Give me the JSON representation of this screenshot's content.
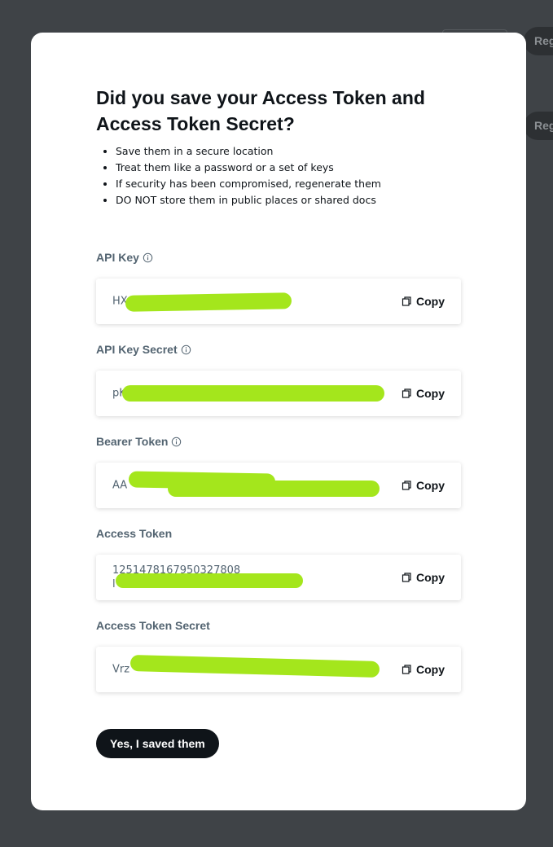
{
  "background": {
    "button_1_label": "Reg",
    "button_2_label": "Reg"
  },
  "modal": {
    "title": "Did you save your Access Token and Access Token Secret?",
    "bullets": [
      "Save them in a secure location",
      "Treat them like a password or a set of keys",
      "If security has been compromised, regenerate them",
      "DO NOT store them in public places or shared docs"
    ],
    "fields": [
      {
        "label": "API Key",
        "has_info": true,
        "value": "HX",
        "copy_label": "Copy"
      },
      {
        "label": "API Key Secret",
        "has_info": true,
        "value": "pK",
        "copy_label": "Copy"
      },
      {
        "label": "Bearer Token",
        "has_info": true,
        "value": "AA",
        "copy_label": "Copy"
      },
      {
        "label": "Access Token",
        "has_info": false,
        "value": "1251478167950327808\nl",
        "copy_label": "Copy"
      },
      {
        "label": "Access Token Secret",
        "has_info": false,
        "value": "Vrz",
        "copy_label": "Copy"
      }
    ],
    "confirm_label": "Yes, I saved them"
  },
  "colors": {
    "overlay": "#3f4347",
    "redaction": "#a4e61c",
    "primary_button": "#0f1419",
    "label_text": "#536471"
  }
}
